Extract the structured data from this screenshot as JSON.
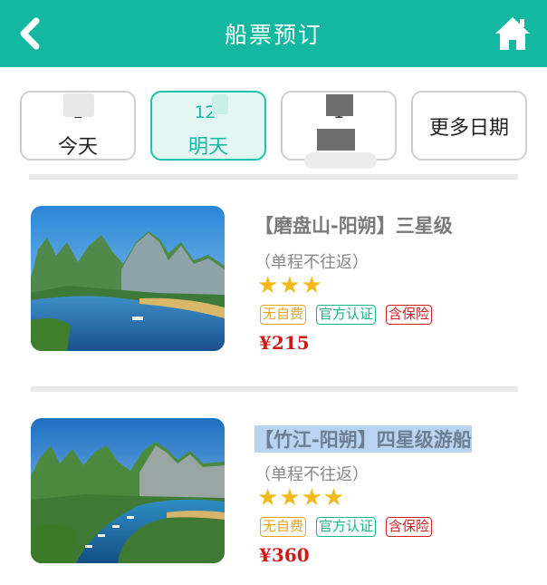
{
  "header": {
    "title": "船票预订",
    "back_icon": "chevron-left-icon",
    "home_icon": "home-icon",
    "bg_color": "#14b8a0"
  },
  "dates": [
    {
      "date": "1",
      "weekday": "今天",
      "active": false
    },
    {
      "date": "12-",
      "weekday": "明天",
      "active": true
    },
    {
      "date": "1",
      "weekday": "",
      "active": false
    },
    {
      "label": "更多日期"
    }
  ],
  "tickets": [
    {
      "title": "【磨盘山-阳朔】三星级",
      "subtitle": "（单程不往返）",
      "stars": "★★★",
      "tags": [
        "无自费",
        "官方认证",
        "含保险"
      ],
      "price": "¥215"
    },
    {
      "title": "【竹江-阳朔】四星级游船",
      "subtitle": "（单程不往返）",
      "stars": "★★★★",
      "tags": [
        "无自费",
        "官方认证",
        "含保险"
      ],
      "price": "¥360"
    }
  ],
  "colors": {
    "accent": "#14b8a0",
    "price": "#d11818",
    "star": "#f3b91b"
  }
}
